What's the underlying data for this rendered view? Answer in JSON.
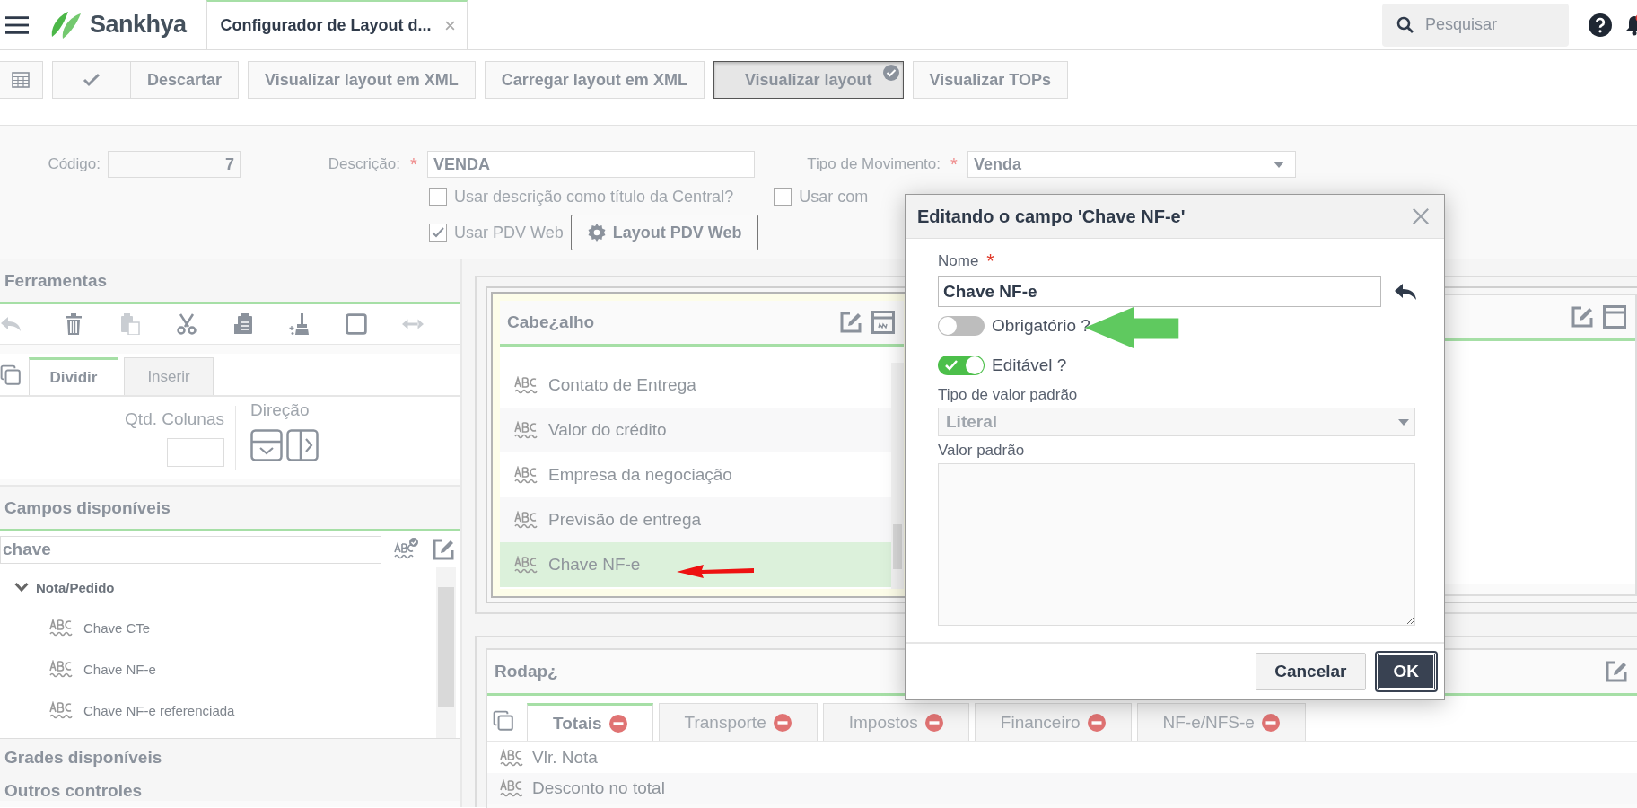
{
  "app": {
    "logo": "Sankhya",
    "tab_title": "Configurador de Layout d...",
    "search_placeholder": "Pesquisar"
  },
  "toolbar": [
    {
      "kind": "grid",
      "pressed": false
    },
    {
      "kind": "check",
      "pressed": false
    },
    {
      "kind": "text",
      "label": "Descartar",
      "pressed": false
    },
    {
      "kind": "text",
      "label": "Visualizar layout em XML",
      "pressed": false
    },
    {
      "kind": "text",
      "label": "Carregar layout em XML",
      "pressed": false
    },
    {
      "kind": "text",
      "label": "Visualizar layout",
      "pressed": true
    },
    {
      "kind": "text",
      "label": "Visualizar TOPs",
      "pressed": false
    }
  ],
  "form": {
    "code": {
      "label": "Código:",
      "value": "7"
    },
    "description": {
      "label": "Descrição:",
      "mark": "*",
      "value": "VENDA"
    },
    "movement_type": {
      "label": "Tipo de Movimento:",
      "mark": "*",
      "value": "Venda"
    },
    "options": [
      {
        "label": "Usar descrição como título da Central?",
        "checked": false
      },
      {
        "label": "Usar com",
        "checked": false
      },
      {
        "label": "Usar PDV Web",
        "checked": true
      }
    ],
    "pdv_button": "Layout PDV Web"
  },
  "tools": {
    "title": "Ferramentas",
    "icons": [
      {
        "kind": "undo",
        "disabled": true
      },
      {
        "kind": "trash",
        "disabled": false
      },
      {
        "kind": "paste",
        "disabled": true
      },
      {
        "kind": "cut",
        "disabled": false
      },
      {
        "kind": "clipboard",
        "disabled": false
      },
      {
        "kind": "broom",
        "disabled": false
      },
      {
        "kind": "square",
        "disabled": false
      },
      {
        "kind": "swap",
        "disabled": true
      }
    ],
    "tabs": [
      {
        "label": "Dividir",
        "selected": true
      },
      {
        "label": "Inserir",
        "selected": false
      }
    ],
    "columns_label": "Qtd. Colunas",
    "direction_label": "Direção"
  },
  "fields": {
    "title": "Campos disponíveis",
    "search": "chave",
    "tree": [
      {
        "label": "Nota/Pedido",
        "expanded": true,
        "children": [
          {
            "label": "Chave CTe"
          },
          {
            "label": "Chave NF-e"
          },
          {
            "label": "Chave NF-e referenciada"
          }
        ]
      }
    ]
  },
  "grids_title": "Grades disponíveis",
  "others_title": "Outros controles",
  "header_panel": {
    "title": "Cabe¿alho",
    "rows": [
      {
        "label": "Contato de Entrega",
        "selected": false
      },
      {
        "label": "Valor do crédito",
        "selected": false
      },
      {
        "label": "Empresa da negociação",
        "selected": false
      },
      {
        "label": "Previsão de entrega",
        "selected": false
      },
      {
        "label": "Chave NF-e",
        "selected": true
      }
    ]
  },
  "footer_panel": {
    "title": "Rodap¿",
    "tabs": [
      {
        "label": "Totais",
        "selected": true
      },
      {
        "label": "Transporte",
        "selected": false
      },
      {
        "label": "Impostos",
        "selected": false
      },
      {
        "label": "Financeiro",
        "selected": false
      },
      {
        "label": "NF-e/NFS-e",
        "selected": false
      }
    ],
    "rows": [
      {
        "label": "Vlr. Nota"
      },
      {
        "label": "Desconto no total"
      }
    ]
  },
  "dialog": {
    "title": "Editando o campo 'Chave NF-e'",
    "name_label": "Nome",
    "mark": "*",
    "name_value": "Chave NF-e",
    "toggles": [
      {
        "label": "Obrigatório ?",
        "on": false
      },
      {
        "label": "Editável ?",
        "on": true
      }
    ],
    "default_type_label": "Tipo de valor padrão",
    "default_type": "Literal",
    "default_value_label": "Valor padrão",
    "buttons": [
      {
        "label": "Cancelar",
        "primary": false
      },
      {
        "label": "OK",
        "primary": true
      }
    ]
  }
}
